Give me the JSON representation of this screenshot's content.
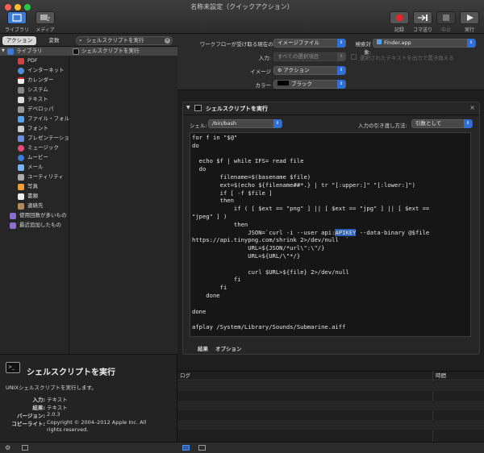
{
  "window": {
    "title": "名称未設定（クイックアクション）"
  },
  "toolbar": {
    "library_label": "ライブラリ",
    "media_label": "メディア",
    "record_label": "記録",
    "step_label": "コマ送り",
    "stop_label": "中止",
    "run_label": "実行"
  },
  "left": {
    "tab_actions": "アクション",
    "tab_variables": "変数",
    "search_value": "シェルスクリプトを実行",
    "categories": [
      {
        "label": "ライブラリ",
        "icon": "library-folder-icon"
      },
      {
        "label": "PDF",
        "icon": "pdf-icon"
      },
      {
        "label": "インターネット",
        "icon": "internet-icon"
      },
      {
        "label": "カレンダー",
        "icon": "calendar-icon"
      },
      {
        "label": "システム",
        "icon": "system-icon"
      },
      {
        "label": "テキスト",
        "icon": "text-icon"
      },
      {
        "label": "デベロッパ",
        "icon": "developer-icon"
      },
      {
        "label": "ファイル・フォルダ",
        "icon": "finder-icon"
      },
      {
        "label": "フォント",
        "icon": "font-icon"
      },
      {
        "label": "プレゼンテーション",
        "icon": "presentation-icon"
      },
      {
        "label": "ミュージック",
        "icon": "music-icon"
      },
      {
        "label": "ムービー",
        "icon": "movie-icon"
      },
      {
        "label": "メール",
        "icon": "mail-icon"
      },
      {
        "label": "ユーティリティ",
        "icon": "utility-icon"
      },
      {
        "label": "写真",
        "icon": "photos-icon"
      },
      {
        "label": "書類",
        "icon": "document-icon"
      },
      {
        "label": "連絡先",
        "icon": "contacts-icon"
      },
      {
        "label": "使用回数が多いもの",
        "icon": "smart-folder-icon"
      },
      {
        "label": "最近追加したもの",
        "icon": "smart-folder-icon"
      }
    ],
    "actions": [
      {
        "label": "シェルスクリプトを実行",
        "icon": "terminal-icon"
      }
    ]
  },
  "description": {
    "title": "シェルスクリプトを実行",
    "summary": "UNIXシェルスクリプトを実行します。",
    "input_label": "入力:",
    "input_value": "テキスト",
    "result_label": "結果:",
    "result_value": "テキスト",
    "version_label": "バージョン:",
    "version_value": "2.0.3",
    "copyright_label": "コピーライト:",
    "copyright_value_1": "Copyright © 2004–2012 Apple Inc.  All",
    "copyright_value_2": "rights reserved."
  },
  "workflow": {
    "receives_label": "ワークフローが受け取る現在の項目:",
    "receives_value": "イメージファイル",
    "in_label": "検索対象:",
    "in_value": "Finder.app",
    "input_label": "入力:",
    "input_value": "すべての選択項目",
    "replace_checkbox_label": "選択されたテキストを出力で置き換える",
    "image_label": "イメージ",
    "image_value": "アクション",
    "color_label": "カラー",
    "color_value": "ブラック"
  },
  "action": {
    "title": "シェルスクリプトを実行",
    "shell_label": "シェル:",
    "shell_value": "/bin/bash",
    "pass_label": "入力の引き渡し方法:",
    "pass_value": "引数として",
    "code_lines": [
      "for f in \"$@\"",
      "do",
      "",
      "  echo $f | while IFS= read file",
      "  do",
      "        filename=$(basename $file)",
      "        ext=$(echo ${filename##*.} | tr \"[:upper:]\" \"[:lower:]\")",
      "        if [ -f $file ]",
      "        then",
      "            if ( [ $ext == \"png\" ] || [ $ext == \"jpg\" ] || [ $ext ==",
      "\"jpeg\" ] )",
      "            then",
      "                JSON=`curl -i --user api:APIKEY --data-binary @$file",
      "https://api.tinypng.com/shrink 2>/dev/null  `",
      "                URL=${JSON/*url\\\":\\\"/}",
      "                URL=${URL/\\\"*/}",
      "",
      "                curl $URL>${file} 2>/dev/null",
      "            fi",
      "        fi",
      "    done",
      "",
      "done",
      "",
      "afplay /System/Library/Sounds/Submarine.aiff"
    ],
    "highlight_word": "APIKEY",
    "tab_results": "結果",
    "tab_options": "オプション"
  },
  "log": {
    "col_log": "ログ",
    "col_time": "時間"
  }
}
